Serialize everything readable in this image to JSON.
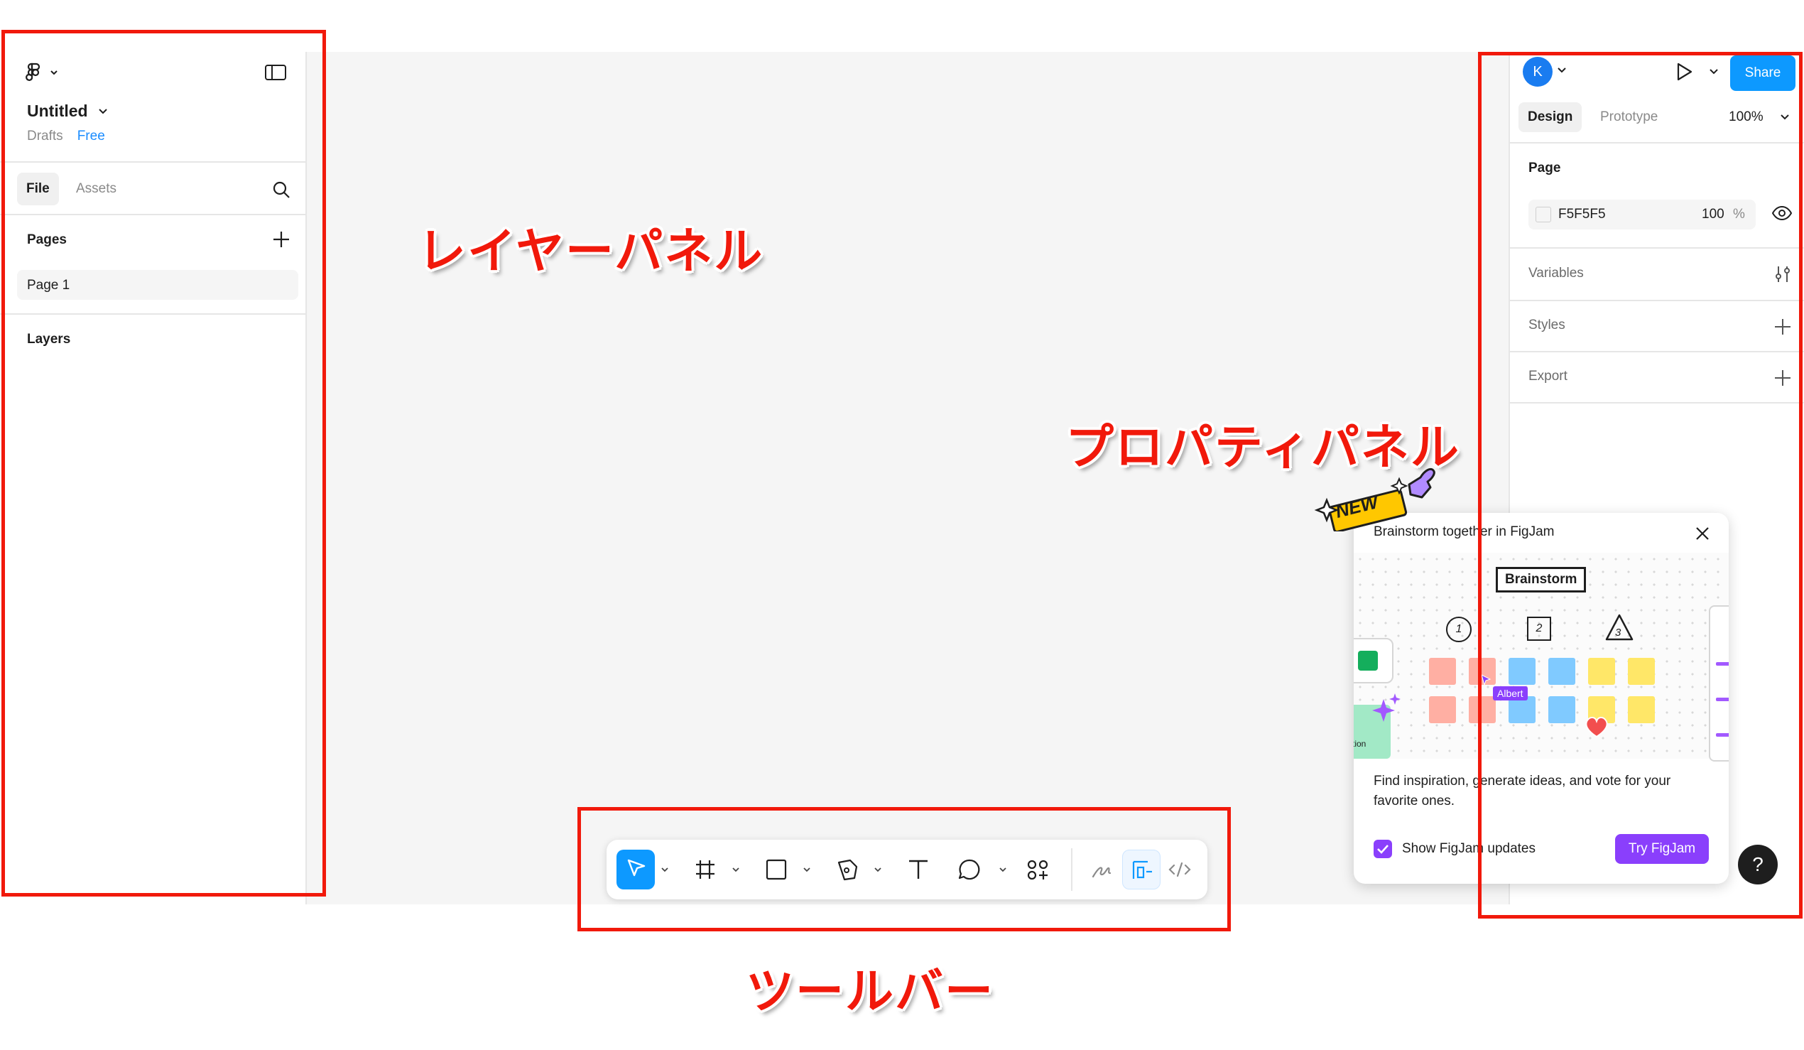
{
  "left_panel": {
    "file_title": "Untitled",
    "location": "Drafts",
    "plan_badge": "Free",
    "tabs": [
      "File",
      "Assets"
    ],
    "pages_label": "Pages",
    "pages": [
      "Page 1"
    ],
    "layers_label": "Layers"
  },
  "right_panel": {
    "avatar_initial": "K",
    "share_label": "Share",
    "tabs": [
      "Design",
      "Prototype"
    ],
    "zoom": "100%",
    "page_section": "Page",
    "page_color": "F5F5F5",
    "page_opacity": "100",
    "page_opacity_unit": "%",
    "sections": [
      "Variables",
      "Styles",
      "Export"
    ]
  },
  "popup": {
    "new_badge": "NEW",
    "title": "Brainstorm together in FigJam",
    "illustration": {
      "header_label": "Brainstorm",
      "steps": [
        "1",
        "2",
        "3"
      ],
      "cursor_name": "Albert",
      "side_label": "tion"
    },
    "description": "Find inspiration, generate ideas, and vote for your favorite ones.",
    "checkbox_label": "Show FigJam updates",
    "checkbox_checked": true,
    "cta_label": "Try FigJam"
  },
  "toolbar": {
    "tools": [
      "move-tool",
      "frame-tool",
      "shape-tool",
      "pen-tool",
      "text-tool",
      "comment-tool",
      "actions-tool",
      "draw-mode",
      "design-mode",
      "dev-mode"
    ],
    "active_tool": "move-tool"
  },
  "help_label": "?",
  "annotations": {
    "layers_panel": "レイヤーパネル",
    "properties_panel": "プロパティパネル",
    "toolbar": "ツールバー"
  },
  "colors": {
    "accent_blue": "#0d99ff",
    "figjam_purple": "#8a3ffc",
    "annotation_red": "#f1190b",
    "canvas_bg": "#f5f5f5"
  }
}
